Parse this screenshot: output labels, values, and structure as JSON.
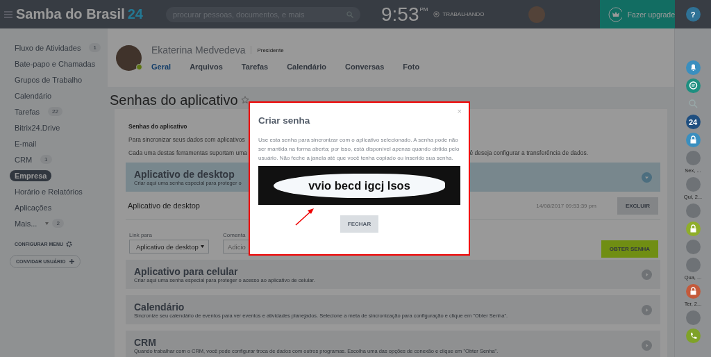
{
  "header": {
    "logo": "Samba do Brasil",
    "logo_number": "24",
    "search": {
      "placeholder": "procurar pessoas, documentos, e mais"
    },
    "clock": "9:53",
    "clock_suffix": "PM",
    "status": "TRABALHANDO",
    "upgrade": "Fazer upgrade"
  },
  "sidebar": {
    "items": [
      {
        "label": "Fluxo de Atividades",
        "count": "1",
        "selected": false
      },
      {
        "label": "Bate-papo e Chamadas",
        "selected": false
      },
      {
        "label": "Grupos de Trabalho",
        "selected": false
      },
      {
        "label": "Calendário",
        "selected": false
      },
      {
        "label": "Tarefas",
        "count": "22",
        "selected": false
      },
      {
        "label": "Bitrix24.Drive",
        "selected": false
      },
      {
        "label": "E-mail",
        "selected": false
      },
      {
        "label": "CRM",
        "count": "1",
        "selected": false
      },
      {
        "label": "Empresa",
        "selected": true
      },
      {
        "label": "Horário e Relatórios",
        "selected": false
      },
      {
        "label": "Aplicações",
        "selected": false
      },
      {
        "label": "Mais...",
        "count": "2",
        "selected": false,
        "caret": true
      }
    ],
    "configure": "CONFIGURAR MENU",
    "invite": "CONVIDAR USUÁRIO"
  },
  "profile": {
    "name": "Ekaterina Medvedeva",
    "role": "Presidente",
    "online": true,
    "tabs": [
      {
        "label": "Geral",
        "selected": true
      },
      {
        "label": "Arquivos",
        "selected": false
      },
      {
        "label": "Tarefas",
        "selected": false
      },
      {
        "label": "Calendário",
        "selected": false
      },
      {
        "label": "Conversas",
        "selected": false
      },
      {
        "label": "Foto",
        "selected": false
      }
    ]
  },
  "page_title": "Senhas do aplicativo",
  "card": {
    "heading": "Senhas do aplicativo",
    "intro_1": "Para sincronizar seus dados com aplicativos",
    "intro_2": "Cada uma destas ferramentas suportam uma",
    "intro_2_end": "ê deseja configurar a transferência de dados.",
    "sections": [
      {
        "title": "Aplicativo de desktop",
        "description": "Criar aqui uma senha especial para proteger o",
        "expanded": true,
        "passwords": [
          {
            "name": "Aplicativo de desktop",
            "date": "14/08/2017 09:53:39 pm",
            "action": "EXCLUIR"
          }
        ],
        "form": {
          "link_label": "Link para",
          "link_value": "Aplicativo de desktop",
          "comment_label": "Comenta",
          "comment_placeholder": "Adicio",
          "submit": "OBTER SENHA"
        }
      },
      {
        "title": "Aplicativo para celular",
        "description": "Criar aqui uma senha especial para proteger o acesso ao aplicativo de celular.",
        "expanded": false
      },
      {
        "title": "Calendário",
        "description": "Sincronize seu calendário de eventos para ver eventos e atividades planejados. Selecione a meta de sincronização para configuração e clique em \"Obter Senha\".",
        "expanded": false
      },
      {
        "title": "CRM",
        "description": "Quando trabalhar com o CRM, você pode configurar troca de dados com outros programas. Escolha uma das opções de conexão e clique em \"Obter Senha\".",
        "expanded": false
      }
    ]
  },
  "right_bar": [
    {
      "kind": "help",
      "text": "?"
    },
    {
      "kind": "bell"
    },
    {
      "kind": "chat"
    },
    {
      "kind": "search"
    },
    {
      "kind": "badge",
      "text": "24"
    },
    {
      "kind": "lock",
      "color": "#3a8fbf"
    },
    {
      "kind": "avatar",
      "caption": "Sex, ..."
    },
    {
      "kind": "avatar",
      "caption": "Qui, 2..."
    },
    {
      "kind": "avatar"
    },
    {
      "kind": "lock",
      "color": "#8fae2a"
    },
    {
      "kind": "avatar"
    },
    {
      "kind": "avatar",
      "caption": "Qua, ..."
    },
    {
      "kind": "lock",
      "color": "#c45a3b",
      "caption": "Ter, 2..."
    },
    {
      "kind": "avatar"
    },
    {
      "kind": "phone"
    }
  ],
  "modal": {
    "close_icon": "×",
    "title": "Criar senha",
    "text": "Use esta senha para sincronizar com o aplicativo selecionado. A senha pode não ser mantida na forma aberta; por isso, está disponível apenas quando obtida pelo usuário. Não feche a janela até que você tenha copiado ou inserido sua senha.",
    "password": "vvio becd igcj lsos",
    "close_button": "FECHAR"
  }
}
